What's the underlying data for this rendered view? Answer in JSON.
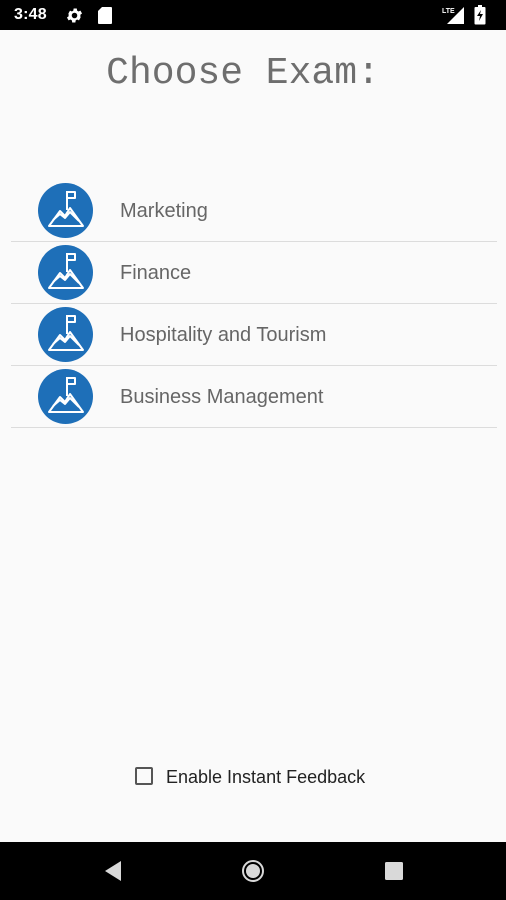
{
  "status_bar": {
    "time": "3:48",
    "icons": [
      "settings-icon",
      "sd-card-icon",
      "lte-signal-icon",
      "battery-charging-icon"
    ]
  },
  "title": "Choose Exam:",
  "exams": [
    {
      "label": "Marketing",
      "icon": "mountain-flag-icon"
    },
    {
      "label": "Finance",
      "icon": "mountain-flag-icon"
    },
    {
      "label": "Hospitality and Tourism",
      "icon": "mountain-flag-icon"
    },
    {
      "label": "Business Management",
      "icon": "mountain-flag-icon"
    }
  ],
  "feedback_checkbox": {
    "label": "Enable Instant Feedback",
    "checked": false
  },
  "nav_bar": {
    "buttons": [
      "back-icon",
      "home-icon",
      "recents-icon"
    ]
  },
  "colors": {
    "accent": "#1e6fb8",
    "background": "#fafafa",
    "title_text": "#6e6e6e",
    "item_text": "#666666"
  }
}
